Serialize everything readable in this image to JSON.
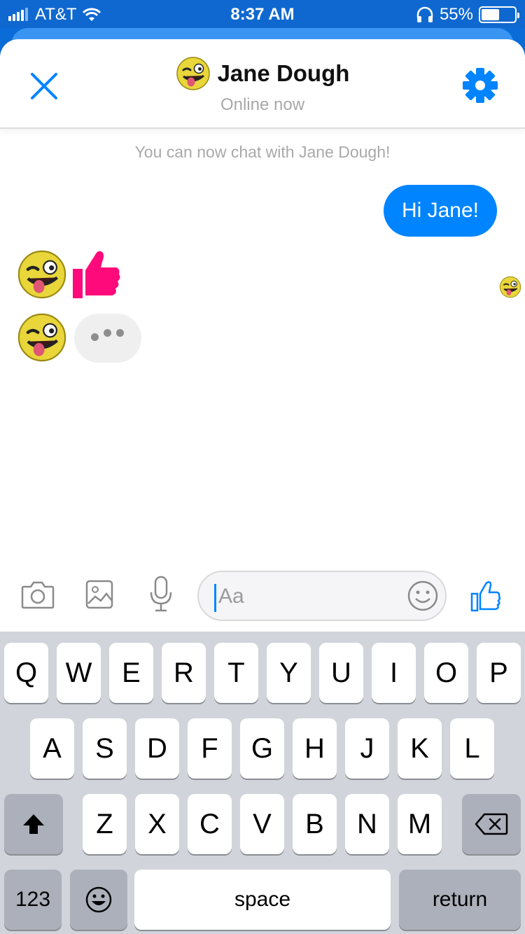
{
  "status_bar": {
    "carrier": "AT&T",
    "time": "8:37 AM",
    "battery_percent": "55%",
    "battery_level": 0.55
  },
  "header": {
    "title": "Jane Dough",
    "subtitle": "Online now",
    "close_icon": "close-icon",
    "settings_icon": "gear-icon"
  },
  "conversation": {
    "system_message": "You can now chat with Jane Dough!",
    "outgoing_message": "Hi Jane!",
    "incoming_sticker": "thumbs-up-icon",
    "typing_indicator": "typing-dots"
  },
  "composer": {
    "placeholder": "Aa",
    "value": "",
    "icons": [
      "camera-icon",
      "image-icon",
      "microphone-icon",
      "smiley-icon",
      "thumbs-up-icon"
    ]
  },
  "keyboard": {
    "row1": [
      "Q",
      "W",
      "E",
      "R",
      "T",
      "Y",
      "U",
      "I",
      "O",
      "P"
    ],
    "row2": [
      "A",
      "S",
      "D",
      "F",
      "G",
      "H",
      "J",
      "K",
      "L"
    ],
    "row3": [
      "Z",
      "X",
      "C",
      "V",
      "B",
      "N",
      "M"
    ],
    "numbers_label": "123",
    "space_label": "space",
    "return_label": "return"
  },
  "colors": {
    "accent": "#0084ff",
    "sticker": "#ff0a7a",
    "status_bar": "#0f68cf"
  }
}
